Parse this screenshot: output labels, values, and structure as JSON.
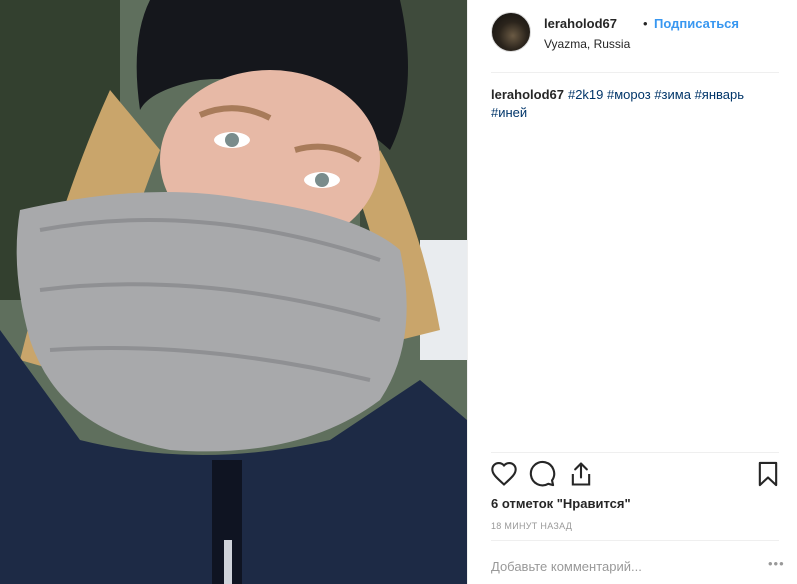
{
  "post": {
    "author": {
      "username": "leraholod67",
      "location": "Vyazma, Russia"
    },
    "follow_label": "Подписаться",
    "dot": "•",
    "caption": {
      "username": "leraholod67",
      "hashtags": [
        "#2k19",
        "#мороз",
        "#зима",
        "#январь",
        "#иней"
      ]
    },
    "likes_text": "6 отметок \"Нравится\"",
    "timestamp": "18 МИНУТ НАЗАД",
    "comment_placeholder": "Добавьте комментарий...",
    "more_label": "•••"
  },
  "icons": {
    "like": "heart-icon",
    "comment": "comment-icon",
    "share": "share-icon",
    "save": "bookmark-icon"
  },
  "colors": {
    "link_blue": "#3897f0",
    "hashtag": "#003569",
    "muted": "#999999",
    "divider": "#efefef"
  }
}
